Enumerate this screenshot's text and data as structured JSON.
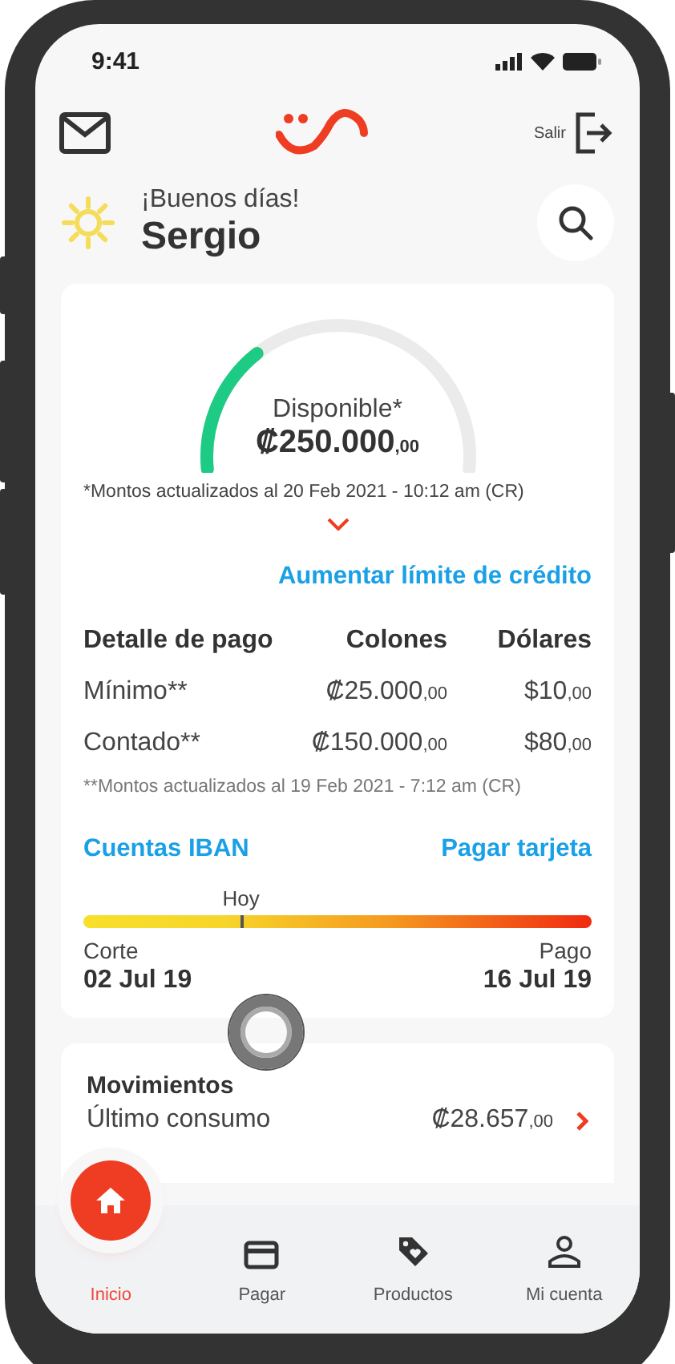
{
  "status_bar": {
    "time": "9:41"
  },
  "header": {
    "logout_label": "Salir"
  },
  "greeting": {
    "salutation": "¡Buenos días!",
    "name": "Sergio"
  },
  "balance": {
    "label": "Disponible*",
    "amount": "₡250.000",
    "cents": ",00",
    "note": "*Montos actualizados al 20 Feb 2021 - 10:12 am (CR)",
    "expanded": false,
    "link": "Aumentar límite de crédito"
  },
  "payment_table": {
    "columns": [
      "Detalle de pago",
      "Colones",
      "Dólares"
    ],
    "rows": [
      {
        "label": "Mínimo**",
        "colones": "₡25.000",
        "colones_cents": ",00",
        "dolares": "$10",
        "dolares_cents": ",00"
      },
      {
        "label": "Contado**",
        "colones": "₡150.000",
        "colones_cents": ",00",
        "dolares": "$80",
        "dolares_cents": ",00"
      }
    ],
    "note": "**Montos actualizados al 19 Feb 2021 - 7:12 am (CR)"
  },
  "links": [
    "Cuentas IBAN",
    "Pagar tarjeta"
  ],
  "timeline": {
    "marker_label": "Hoy",
    "level": 0.31,
    "start_label": "Corte",
    "start_date": "02 Jul 19",
    "end_label": "Pago",
    "end_date": "16 Jul 19"
  },
  "movements": {
    "title": "Movimientos",
    "label": "Último consumo",
    "amount": "₡28.657",
    "cents": ",00"
  },
  "bottom_nav": [
    {
      "label": "Inicio",
      "kind": "home",
      "selected": true
    },
    {
      "label": "Pagar",
      "kind": "card",
      "selected": false
    },
    {
      "label": "Productos",
      "kind": "tag",
      "selected": false
    },
    {
      "label": "Mi cuenta",
      "kind": "person",
      "selected": false
    }
  ]
}
